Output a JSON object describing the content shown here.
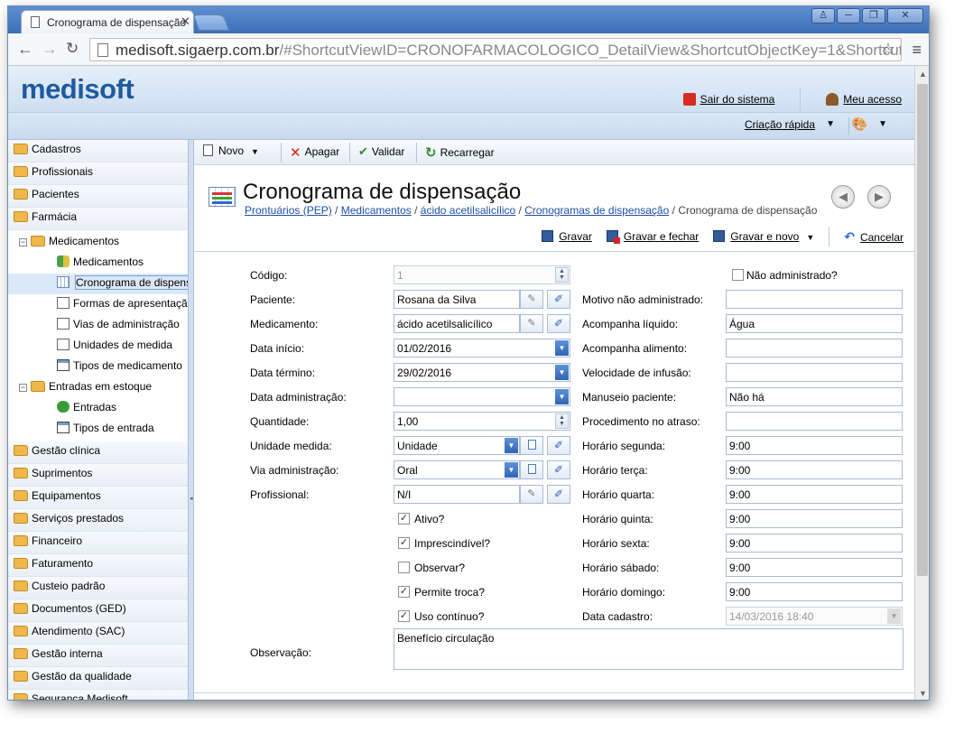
{
  "browser": {
    "tab_title": "Cronograma de dispensação",
    "tab_close": "✕",
    "url_host": "medisoft.sigaerp.com.br",
    "url_path": "/#ShortcutViewID=CRONOFARMACOLOGICO_DetailView&ShortcutObjectKey=1&ShortcutObje"
  },
  "app": {
    "logo": "medisoft",
    "logout_label": "Sair do sistema",
    "account_label": "Meu acesso",
    "quick_create_label": "Criação rápida"
  },
  "sidebar": {
    "groups_top": [
      "Cadastros",
      "Profissionais",
      "Pacientes",
      "Farmácia"
    ],
    "tree": {
      "medicamentos_node": "Medicamentos",
      "medicamentos_children": [
        "Medicamentos",
        "Cronograma de dispens",
        "Formas de apresentaçã",
        "Vias de administração",
        "Unidades de medida",
        "Tipos de medicamento"
      ],
      "estoque_node": "Entradas em estoque",
      "estoque_children": [
        "Entradas",
        "Tipos de entrada"
      ]
    },
    "groups_bottom": [
      "Gestão clínica",
      "Suprimentos",
      "Equipamentos",
      "Serviços prestados",
      "Financeiro",
      "Faturamento",
      "Custeio padrão",
      "Documentos (GED)",
      "Atendimento (SAC)",
      "Gestão interna",
      "Gestão da qualidade",
      "Segurança Medisoft"
    ]
  },
  "toolbar": {
    "new_label": "Novo",
    "delete_label": "Apagar",
    "validate_label": "Validar",
    "reload_label": "Recarregar"
  },
  "page": {
    "title": "Cronograma de dispensação",
    "breadcrumb": [
      "Prontuários (PEP)",
      "Medicamentos",
      "ácido acetilsalicílico",
      "Cronogramas de dispensação"
    ],
    "breadcrumb_current": "Cronograma de dispensação",
    "separator": " / "
  },
  "actions": {
    "save": "Gravar",
    "save_close": "Gravar e fechar",
    "save_new": "Gravar e novo",
    "cancel": "Cancelar"
  },
  "form": {
    "left_labels": {
      "codigo": "Código:",
      "paciente": "Paciente:",
      "medicamento": "Medicamento:",
      "data_inicio": "Data início:",
      "data_termino": "Data término:",
      "data_administracao": "Data administração:",
      "quantidade": "Quantidade:",
      "unidade_medida": "Unidade medida:",
      "via_administracao": "Via administração:",
      "profissional": "Profissional:",
      "observacao": "Observação:"
    },
    "left_values": {
      "codigo": "1",
      "paciente": "Rosana da Silva",
      "medicamento": "ácido acetilsalicílico",
      "data_inicio": "01/02/2016",
      "data_termino": "29/02/2016",
      "data_administracao": "",
      "quantidade": "1,00",
      "unidade_medida": "Unidade",
      "via_administracao": "Oral",
      "profissional": "N/I",
      "observacao": "Benefício circulação"
    },
    "checkboxes": {
      "ativo": {
        "label": "Ativo?",
        "checked": true
      },
      "imprescindivel": {
        "label": "Imprescindível?",
        "checked": true
      },
      "observar": {
        "label": "Observar?",
        "checked": false
      },
      "permite_troca": {
        "label": "Permite troca?",
        "checked": true
      },
      "uso_continuo": {
        "label": "Uso contínuo?",
        "checked": true
      },
      "nao_administrado": {
        "label": "Não administrado?",
        "checked": false
      }
    },
    "right_labels": {
      "motivo": "Motivo não administrado:",
      "acompanha_liquido": "Acompanha líquido:",
      "acompanha_alimento": "Acompanha alimento:",
      "velocidade": "Velocidade de infusão:",
      "manuseio": "Manuseio paciente:",
      "procedimento": "Procedimento no atraso:",
      "segunda": "Horário segunda:",
      "terca": "Horário terça:",
      "quarta": "Horário quarta:",
      "quinta": "Horário quinta:",
      "sexta": "Horário sexta:",
      "sabado": "Horário sábado:",
      "domingo": "Horário domingo:",
      "data_cadastro": "Data cadastro:"
    },
    "right_values": {
      "motivo": "",
      "acompanha_liquido": "Água",
      "acompanha_alimento": "",
      "velocidade": "",
      "manuseio": "Não há",
      "procedimento": "",
      "segunda": "9:00",
      "terca": "9:00",
      "quarta": "9:00",
      "quinta": "9:00",
      "sexta": "9:00",
      "sabado": "9:00",
      "domingo": "9:00",
      "data_cadastro": "14/03/2016 18:40"
    }
  },
  "colors": {
    "accent": "#1f5aa0",
    "link": "#1f4fa8",
    "header_bg": "#dbe7f4"
  }
}
